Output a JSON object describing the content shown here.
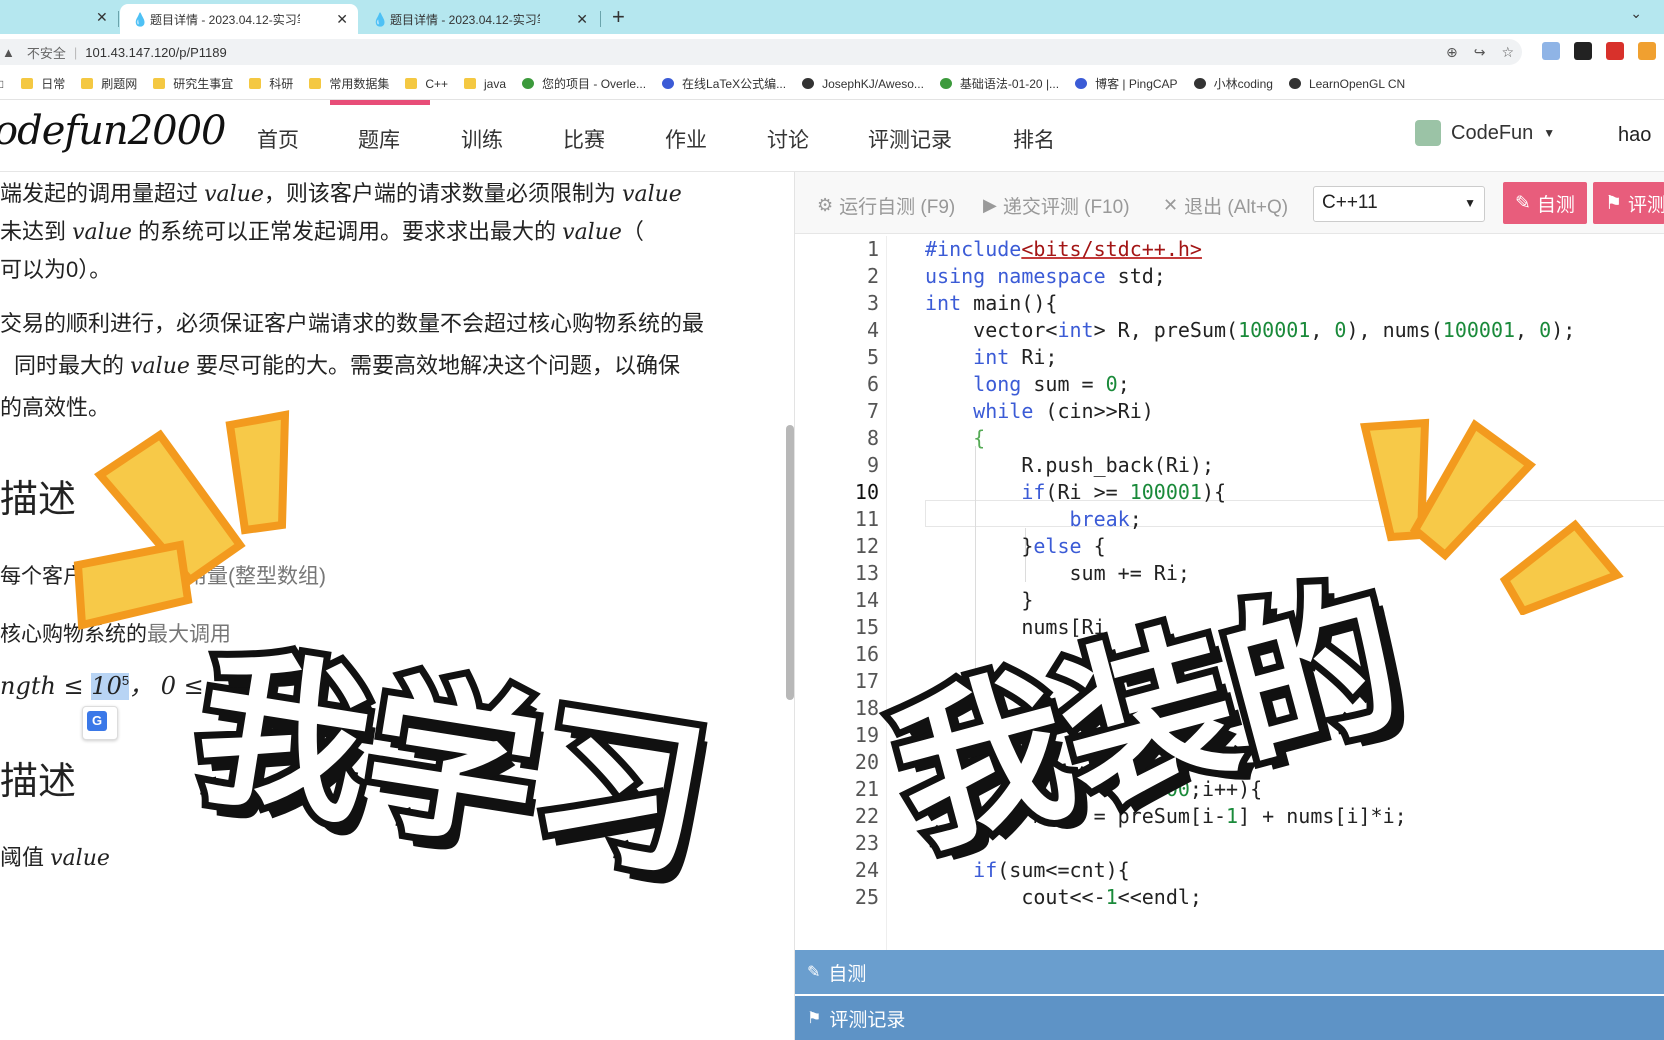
{
  "browser": {
    "tabs": [
      {
        "label": "题目详情 - 2023.04.12-实习笔试",
        "active": true
      },
      {
        "label": "题目详情 - 2023.04.12-实习笔试",
        "active": false
      }
    ],
    "new_tab_symbol": "+",
    "close_symbol": "✕",
    "insecure_label": "不安全",
    "url": "101.43.147.120/p/P1189",
    "bookmarks": [
      "日常",
      "刷题网",
      "研究生事宜",
      "科研",
      "常用数据集",
      "C++",
      "java",
      "您的项目 - Overle...",
      "在线LaTeX公式编...",
      "JosephKJ/Aweso...",
      "基础语法-01-20 |...",
      "博客 | PingCAP",
      "小林coding",
      "LearnOpenGL CN"
    ]
  },
  "site": {
    "logo": "odefun2000",
    "nav": [
      "首页",
      "题库",
      "训练",
      "比赛",
      "作业",
      "讨论",
      "评测记录",
      "排名"
    ],
    "active_nav": "题库",
    "brand": "CodeFun",
    "user": "hao"
  },
  "problem": {
    "line1_a": "端发起的调用量超过 ",
    "line1_b": "，则该客户端的请求数量必须限制为 ",
    "line2_a": "未达到 ",
    "line2_b": " 的系统可以正常发起调用。要求求出最大的 ",
    "line2_c": "（",
    "line3": "可以为0）。",
    "line4": "交易的顺利进行，必须保证客户端请求的数量不会超过核心购物系统的最",
    "line5_a": "同时最大的 ",
    "line5_b": " 要尽可能的大。需要高效地解决这个问题，以确保",
    "line6": "的高效性。",
    "var_value": "value",
    "heading_input": "描述",
    "input_line1_a": "每个客户",
    "input_line1_b": "的调用量(整型数组)",
    "input_line2_a": "核心购物系统的",
    "input_line2_b": "最大调用",
    "constraint_a": "ngth ≤ ",
    "constraint_base": "10",
    "constraint_exp": "5",
    "constraint_b": "， 0 ≤",
    "heading_output": "描述",
    "output_line_a": "阈值 "
  },
  "editor": {
    "run_test": "运行自测 (F9)",
    "submit": "递交评测 (F10)",
    "exit": "退出 (Alt+Q)",
    "language": "C++11",
    "self_test_btn": "自测",
    "judge_btn": "评测",
    "line_numbers": [
      "1",
      "2",
      "3",
      "4",
      "5",
      "6",
      "7",
      "8",
      "9",
      "10",
      "11",
      "12",
      "13",
      "14",
      "15",
      "16",
      "17",
      "18",
      "19",
      "20",
      "21",
      "22",
      "23",
      "24",
      "25"
    ],
    "current_line": 10,
    "panel_self_test": "自测",
    "panel_records": "评测记录"
  },
  "overlays": {
    "left_caption": "我学习",
    "right_caption": "我装的"
  },
  "colors": {
    "tab_strip": "#b5e7ef",
    "accent_pink": "#e85d7c",
    "panel_blue": "#6a9ece",
    "keyword_blue": "#3b5bd6",
    "number_green": "#1a8a3a",
    "burst_yellow": "#f7c948",
    "burst_orange": "#f39a1e"
  },
  "icons": [
    "droplet-icon",
    "close-icon",
    "plus-icon",
    "chevron-down-icon",
    "zoom-icon",
    "share-icon",
    "star-icon",
    "folder-icon",
    "github-icon",
    "bug-icon",
    "play-icon",
    "pencil-icon",
    "flag-icon",
    "translate-icon"
  ]
}
